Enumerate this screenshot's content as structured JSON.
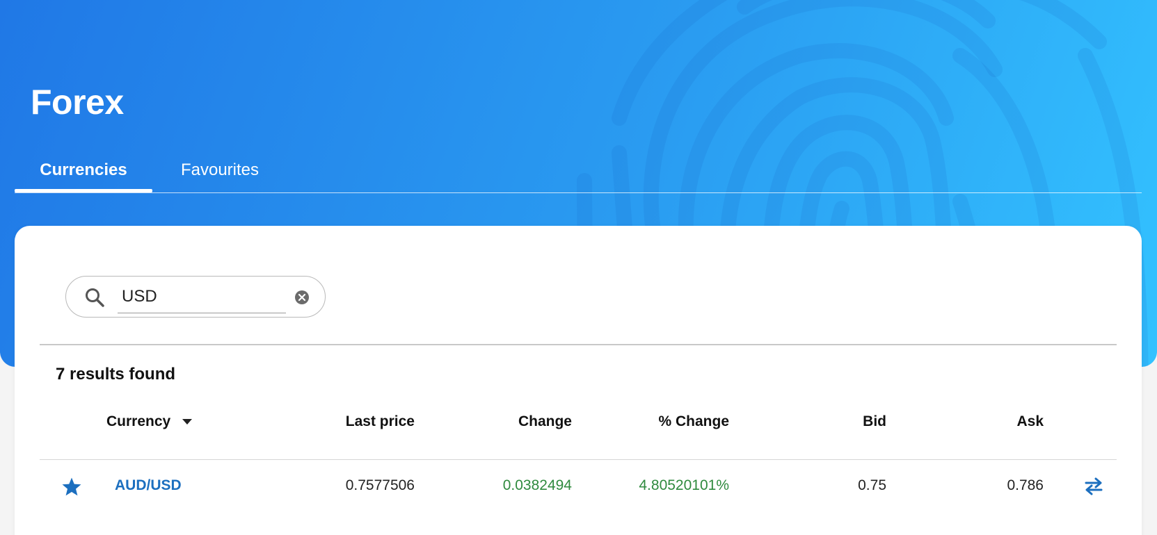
{
  "page": {
    "title": "Forex",
    "tabs": [
      {
        "label": "Currencies",
        "active": true
      },
      {
        "label": "Favourites",
        "active": false
      }
    ]
  },
  "search": {
    "value": "USD",
    "icon": "search-icon",
    "clear_icon": "clear-icon"
  },
  "results": {
    "summary": "7 results found"
  },
  "table": {
    "columns": [
      "Currency",
      "Last price",
      "Change",
      "% Change",
      "Bid",
      "Ask"
    ],
    "sort_icon": "caret-down-icon",
    "rows": [
      {
        "favourite": true,
        "currency": "AUD/USD",
        "last_price": "0.7577506",
        "change": "0.0382494",
        "pct_change": "4.80520101%",
        "bid": "0.75",
        "ask": "0.786",
        "action_icon": "swap-icon"
      }
    ]
  },
  "colors": {
    "brand_gradient_start": "#2078e6",
    "brand_gradient_end": "#33c2ff",
    "link": "#1c6fbf",
    "positive": "#2f8a3e"
  }
}
